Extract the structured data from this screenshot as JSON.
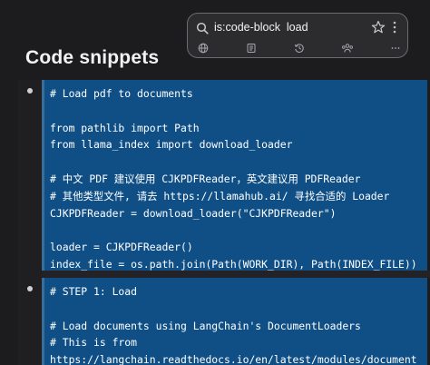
{
  "page": {
    "title": "Code snippets"
  },
  "search": {
    "query": "is:code-block  load"
  },
  "icons": {
    "search": "search-icon",
    "star": "star-icon",
    "more": "more-vertical-icon",
    "filters": [
      "globe-icon",
      "notes-icon",
      "history-icon",
      "people-icon",
      "ellipsis-icon"
    ]
  },
  "blocks": [
    {
      "code": "# Load pdf to documents\n\nfrom pathlib import Path\nfrom llama_index import download_loader\n\n# 中文 PDF 建议使用 CJKPDFReader，英文建议用 PDFReader\n# 其他类型文件, 请去 https://llamahub.ai/ 寻找合适的 Loader\nCJKPDFReader = download_loader(\"CJKPDFReader\")\n\nloader = CJKPDFReader()\nindex_file = os.path.join(Path(WORK_DIR), Path(INDEX_FILE))"
    },
    {
      "code": "# STEP 1: Load\n\n# Load documents using LangChain's DocumentLoaders\n# This is from\nhttps://langchain.readthedocs.io/en/latest/modules/document"
    }
  ],
  "colors": {
    "background": "#1c1c1e",
    "code_background": "#0f4f86",
    "match_underline": "#e8a800"
  }
}
